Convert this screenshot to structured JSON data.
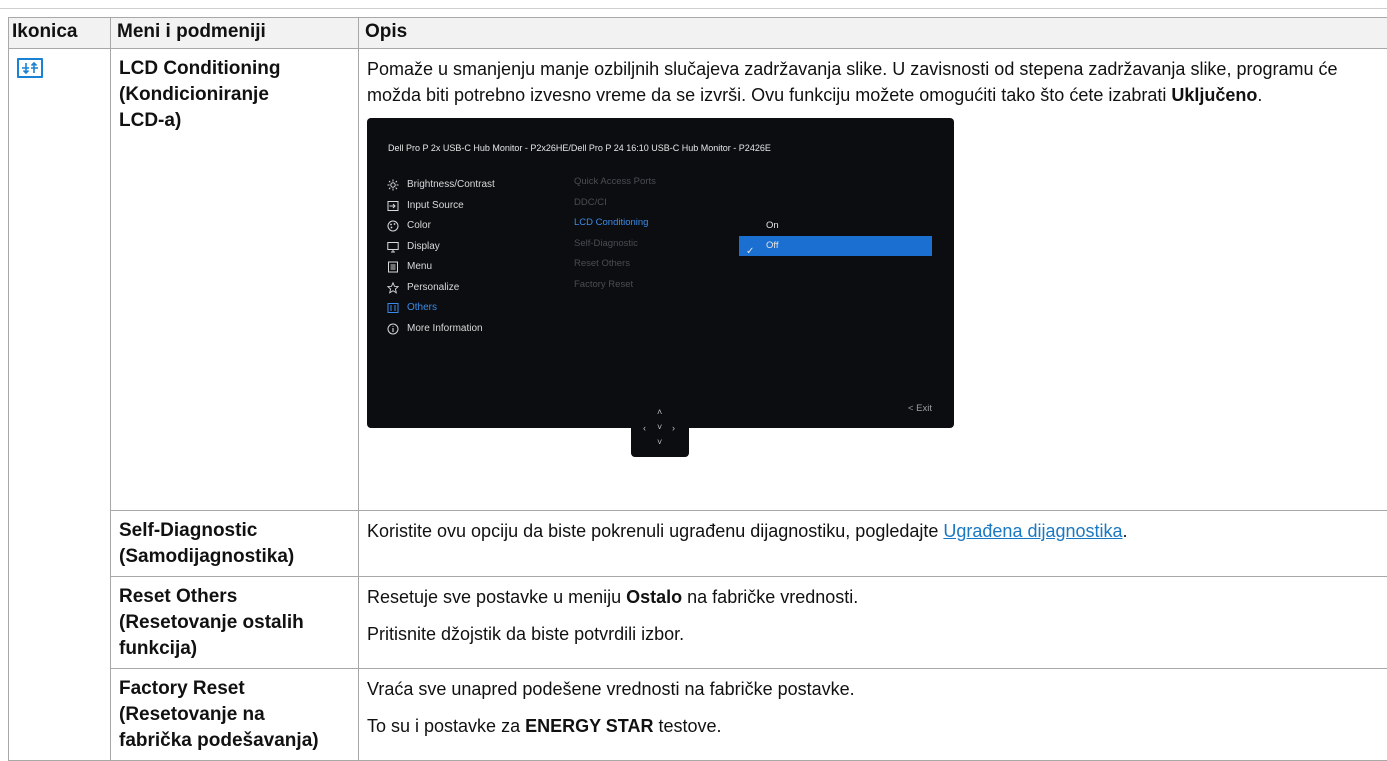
{
  "table": {
    "headers": [
      "Ikonica",
      "Meni i podmeniji",
      "Opis"
    ],
    "rows": {
      "lcd": {
        "menu": [
          "LCD Conditioning",
          "(Kondicioniranje",
          "LCD-a)"
        ],
        "desc_text": "Pomaže u smanjenju manje ozbiljnih slučajeva zadržavanja slike. U zavisnosti od stepena zadržavanja slike, programu će možda biti potrebno izvesno vreme da se izvrši. Ovu funkciju možete omogućiti tako što ćete izabrati ",
        "desc_bold": "Uključeno",
        "desc_end": "."
      },
      "selfdiag": {
        "menu": [
          "Self-Diagnostic",
          "(Samodijagnostika)"
        ],
        "desc_text": "Koristite ovu opciju da biste pokrenuli ugrađenu dijagnostiku, pogledajte ",
        "desc_link": "Ugrađena dijagnostika",
        "desc_end": "."
      },
      "reset_others": {
        "menu": [
          "Reset Others",
          "(Resetovanje ostalih",
          "funkcija)"
        ],
        "line1_pre": "Resetuje sve postavke u meniju ",
        "line1_bold": "Ostalo",
        "line1_post": " na fabričke vrednosti.",
        "line2": "Pritisnite džojstik da biste potvrdili izbor."
      },
      "factory": {
        "menu": [
          "Factory Reset",
          "(Resetovanje na",
          "fabrička podešavanja)"
        ],
        "line1": "Vraća sve unapred podešene vrednosti na fabričke postavke.",
        "line2_pre": "To su i postavke za ",
        "line2_bold": "ENERGY STAR",
        "line2_post": " testove."
      }
    }
  },
  "osd": {
    "title": "Dell Pro P 2x USB-C Hub Monitor - P2x26HE/Dell Pro P 24 16:10 USB-C Hub Monitor - P2426E",
    "menu": [
      {
        "label": "Brightness/Contrast",
        "icon": "brightness-icon"
      },
      {
        "label": "Input Source",
        "icon": "input-source-icon"
      },
      {
        "label": "Color",
        "icon": "color-icon"
      },
      {
        "label": "Display",
        "icon": "display-icon"
      },
      {
        "label": "Menu",
        "icon": "menu-icon"
      },
      {
        "label": "Personalize",
        "icon": "star-icon"
      },
      {
        "label": "Others",
        "icon": "others-icon"
      },
      {
        "label": "More Information",
        "icon": "info-icon"
      }
    ],
    "submenu": [
      "Quick Access Ports",
      "DDC/CI",
      "LCD Conditioning",
      "Self-Diagnostic",
      "Reset Others",
      "Factory Reset"
    ],
    "options": [
      "On",
      "Off"
    ],
    "selected_option": "Off",
    "exit_label": "< Exit",
    "accent_color": "#1a6fd0"
  }
}
